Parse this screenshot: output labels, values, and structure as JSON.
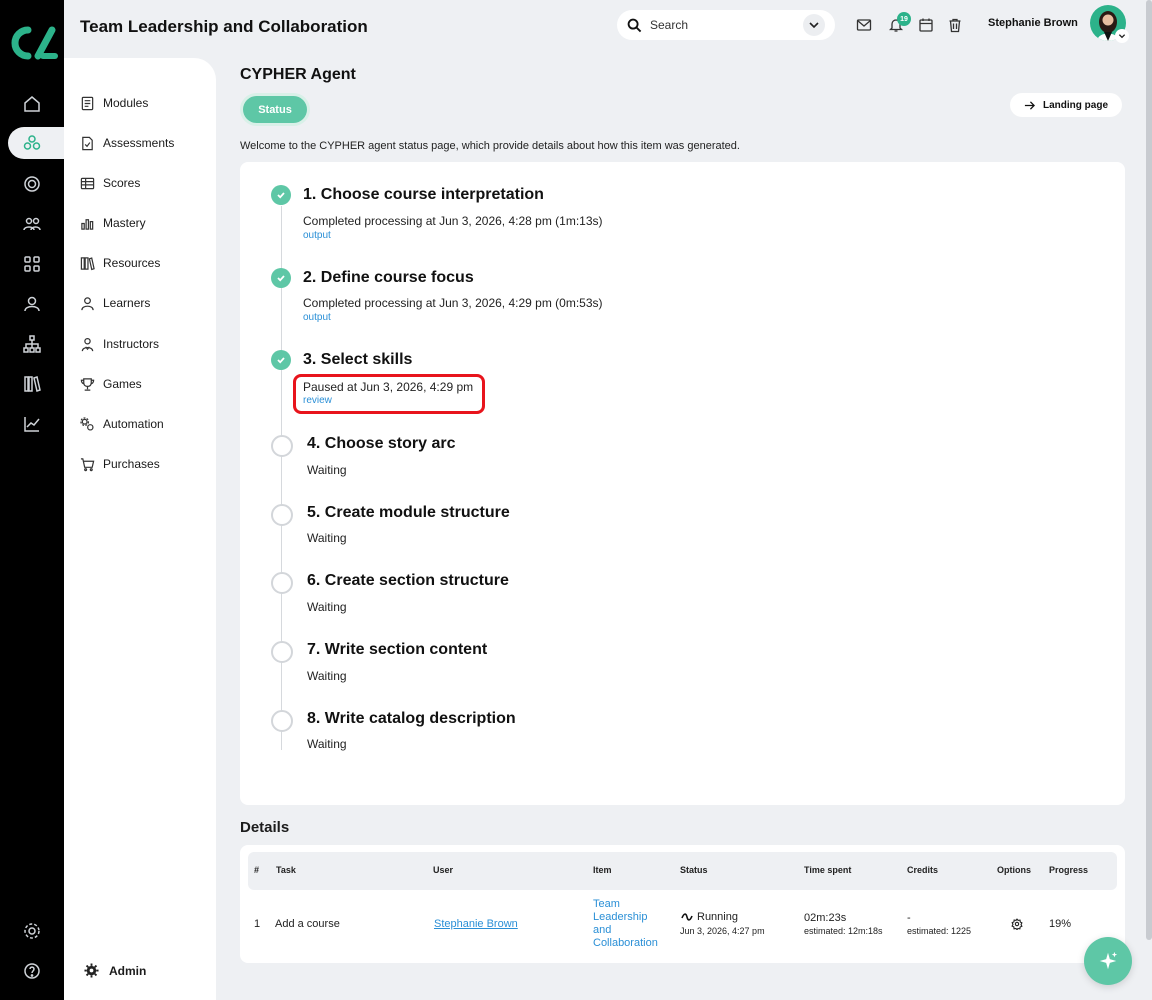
{
  "header": {
    "title": "Team Leadership and Collaboration",
    "search_placeholder": "Search",
    "notification_count": "19",
    "user_name": "Stephanie Brown"
  },
  "sidebar": {
    "items": [
      {
        "label": "Modules",
        "icon": "modules-icon"
      },
      {
        "label": "Assessments",
        "icon": "assessments-icon"
      },
      {
        "label": "Scores",
        "icon": "scores-icon"
      },
      {
        "label": "Mastery",
        "icon": "mastery-icon"
      },
      {
        "label": "Resources",
        "icon": "resources-icon"
      },
      {
        "label": "Learners",
        "icon": "learners-icon"
      },
      {
        "label": "Instructors",
        "icon": "instructors-icon"
      },
      {
        "label": "Games",
        "icon": "games-icon"
      },
      {
        "label": "Automation",
        "icon": "automation-icon"
      },
      {
        "label": "Purchases",
        "icon": "purchases-icon"
      }
    ],
    "admin_label": "Admin"
  },
  "page": {
    "title": "CYPHER Agent",
    "tab_status": "Status",
    "landing_label": "Landing page",
    "intro": "Welcome to the CYPHER agent status page, which provide details about how this item was generated."
  },
  "steps": [
    {
      "title": "1. Choose course interpretation",
      "desc": "Completed processing at Jun 3, 2026, 4:28 pm (1m:13s)",
      "link": "output",
      "state": "done"
    },
    {
      "title": "2. Define course focus",
      "desc": "Completed processing at Jun 3, 2026, 4:29 pm (0m:53s)",
      "link": "output",
      "state": "done"
    },
    {
      "title": "3. Select skills",
      "desc": "Paused at Jun 3, 2026, 4:29 pm",
      "link": "review",
      "state": "paused"
    },
    {
      "title": "4. Choose story arc",
      "desc": "Waiting",
      "state": "waiting"
    },
    {
      "title": "5. Create module structure",
      "desc": "Waiting",
      "state": "waiting"
    },
    {
      "title": "6. Create section structure",
      "desc": "Waiting",
      "state": "waiting"
    },
    {
      "title": "7. Write section content",
      "desc": "Waiting",
      "state": "waiting"
    },
    {
      "title": "8. Write catalog description",
      "desc": "Waiting",
      "state": "waiting"
    }
  ],
  "details": {
    "title": "Details",
    "columns": [
      "#",
      "Task",
      "User",
      "Item",
      "Status",
      "Time spent",
      "Credits",
      "Options",
      "Progress"
    ],
    "row": {
      "num": "1",
      "task": "Add a course",
      "user": "Stephanie Brown",
      "item_lines": [
        "Team",
        "Leadership",
        "and",
        "Collaboration"
      ],
      "status": "Running",
      "status_date": "Jun 3, 2026, 4:27 pm",
      "time_spent": "02m:23s",
      "time_estimated": "estimated: 12m:18s",
      "credits": "-",
      "credits_estimated": "estimated: 1225",
      "progress": "19%"
    }
  },
  "colors": {
    "accent": "#5ec7a6",
    "brand": "#2cb28a",
    "link": "#2a8fd6",
    "highlight": "#e8141c"
  }
}
